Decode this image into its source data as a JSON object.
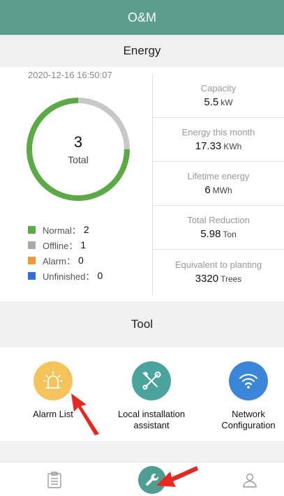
{
  "header": {
    "title": "O&M"
  },
  "energy": {
    "section_title": "Energy",
    "timestamp": "2020-12-16 16:50:07",
    "total": {
      "count": "3",
      "label": "Total"
    },
    "ring": {
      "normal_fraction": 0.75,
      "colors": {
        "normal": "#5aab45",
        "offline": "#c8c8c8"
      }
    },
    "legend": [
      {
        "label": "Normal：",
        "value": "2",
        "color": "#5aab45"
      },
      {
        "label": "Offline：",
        "value": "1",
        "color": "#aaaaaa"
      },
      {
        "label": "Alarm：",
        "value": "0",
        "color": "#f0973a"
      },
      {
        "label": "Unfinished：",
        "value": "0",
        "color": "#2f6fdc"
      }
    ],
    "stats": [
      {
        "label": "Capacity",
        "value": "5.5",
        "unit": "kW"
      },
      {
        "label": "Energy this month",
        "value": "17.33",
        "unit": "KWh"
      },
      {
        "label": "Lifetime energy",
        "value": "6",
        "unit": "MWh"
      },
      {
        "label": "Total Reduction",
        "value": "5.98",
        "unit": "Ton"
      },
      {
        "label": "Equivalent to planting",
        "value": "3320",
        "unit": "Trees"
      }
    ]
  },
  "tool": {
    "section_title": "Tool",
    "items": [
      {
        "label": "Alarm List",
        "icon": "alarm-light-icon",
        "color": "#f3c45b"
      },
      {
        "label": "Local installation\nassistant",
        "icon": "wrench-screwdriver-icon",
        "color": "#4aa39c"
      },
      {
        "label": "Network\nConfiguration",
        "icon": "wifi-icon",
        "color": "#3b86d8"
      }
    ]
  },
  "bottom_nav": {
    "items": [
      {
        "icon": "clipboard-icon"
      },
      {
        "icon": "wrench-icon",
        "active": true,
        "color": "#4d9d90"
      },
      {
        "icon": "person-icon"
      }
    ]
  },
  "annotations": {
    "arrow_color": "#e8281e"
  }
}
